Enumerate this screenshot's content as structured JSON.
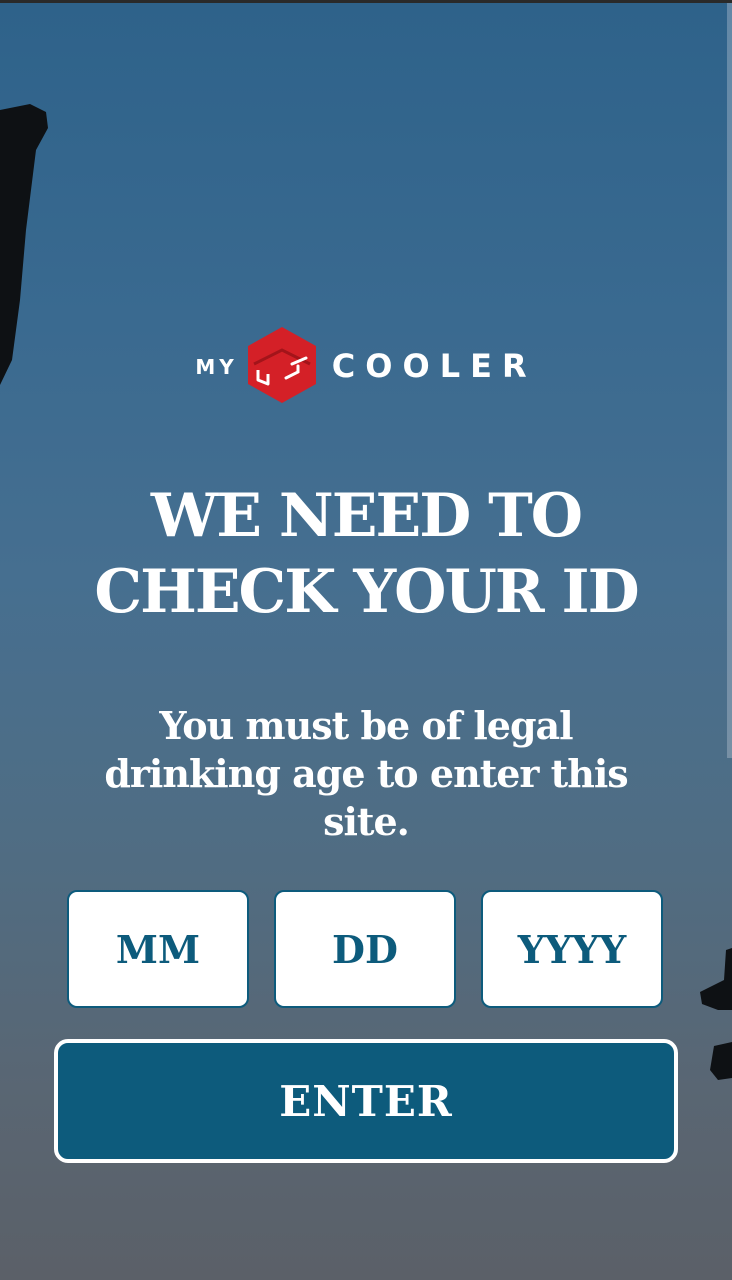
{
  "logo": {
    "prefix": "MY",
    "name": "COOLER",
    "icon": "cooler-box-icon",
    "brand_color": "#d42027"
  },
  "heading": {
    "line1": "WE NEED TO",
    "line2": "CHECK YOUR ID"
  },
  "subtitle": "You must be of legal drinking age to enter this site.",
  "form": {
    "month_placeholder": "MM",
    "day_placeholder": "DD",
    "year_placeholder": "YYYY",
    "submit_label": "ENTER"
  },
  "colors": {
    "accent": "#0d5b7c",
    "text": "#ffffff"
  }
}
